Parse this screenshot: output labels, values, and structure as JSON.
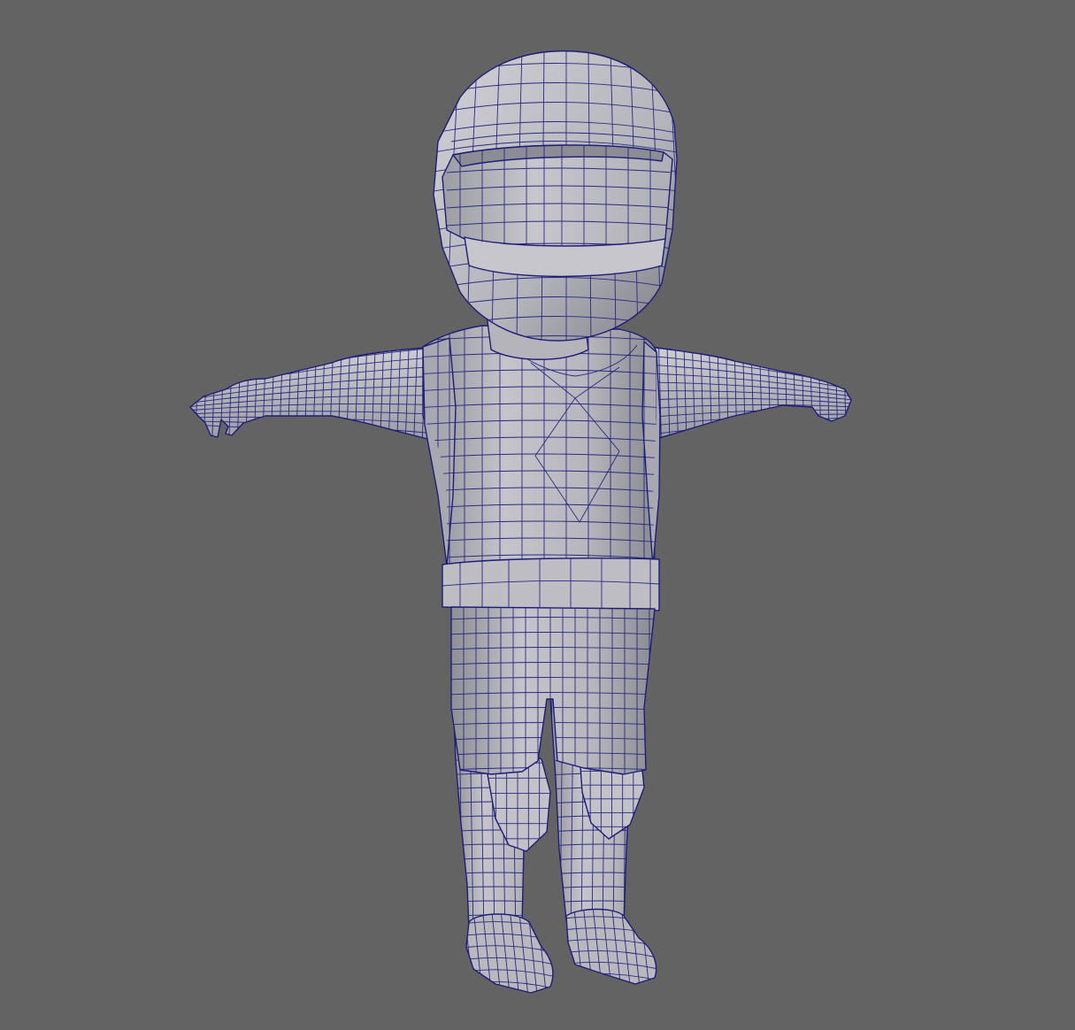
{
  "viewport": {
    "background": "#636363",
    "shading_color": "#b7b7bd",
    "wireframe_color": "#23237e",
    "display_mode": "wireframe-on-shaded",
    "pose": "T-pose"
  },
  "model": {
    "parts": [
      "helmet",
      "visor",
      "neck",
      "torso",
      "vest",
      "left-arm",
      "right-arm",
      "belt",
      "hips",
      "left-leg",
      "right-leg",
      "left-knee-pad",
      "right-knee-pad",
      "left-boot",
      "right-boot"
    ]
  }
}
